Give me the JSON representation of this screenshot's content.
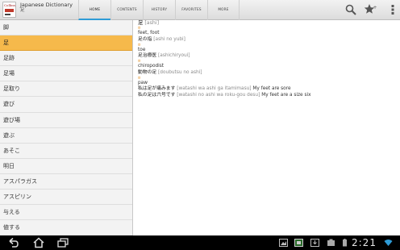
{
  "app": {
    "title": "Japanese Dictionary",
    "subtitle": "足",
    "logo_text": "Collins"
  },
  "tabs": [
    {
      "label": "HOME",
      "active": true
    },
    {
      "label": "CONTENTS",
      "active": false
    },
    {
      "label": "HISTORY",
      "active": false
    },
    {
      "label": "FAVORITES",
      "active": false
    },
    {
      "label": "MORE",
      "active": false
    }
  ],
  "actions": [
    "search-icon",
    "star-add-icon",
    "overflow-menu-icon"
  ],
  "word_list": {
    "items": [
      "脚",
      "足",
      "足跡",
      "足場",
      "足取り",
      "遊び",
      "遊び場",
      "遊ぶ",
      "あそこ",
      "明日",
      "アスパラガス",
      "アスピリン",
      "与える",
      "値する"
    ],
    "selected_index": 1
  },
  "entry": {
    "headword": "足",
    "headword_reading": "[ashi]",
    "senses": [
      {
        "bullet": "¤",
        "gloss": "feet, foot",
        "example_jp": "足の指",
        "example_rom": "[ashi no yubi]"
      },
      {
        "bullet": "¤",
        "gloss": "toe",
        "example_jp": "足治療医",
        "example_rom": "[ashichiryoui]"
      },
      {
        "bullet": "¤",
        "gloss": "chiropodist",
        "example_jp": "動物の足",
        "example_rom": "[doubutsu no ashi]"
      },
      {
        "bullet": "¤",
        "gloss": "paw",
        "examples": [
          {
            "jp": "私は足が痛みます",
            "rom": "[watashi wa ashi ga itamimasu]",
            "en": "My feet are sore"
          },
          {
            "jp": "私の足は六号です",
            "rom": "[watashi no ashi wa roku-gou desu]",
            "en": "My feet are a size six"
          }
        ]
      }
    ]
  },
  "system_bar": {
    "time": "2:21",
    "nav": [
      "back-icon",
      "home-icon",
      "recent-apps-icon"
    ]
  },
  "colors": {
    "accent": "#2e9bd6",
    "selection": "#f6b94b",
    "bullet": "#e08a1a"
  }
}
